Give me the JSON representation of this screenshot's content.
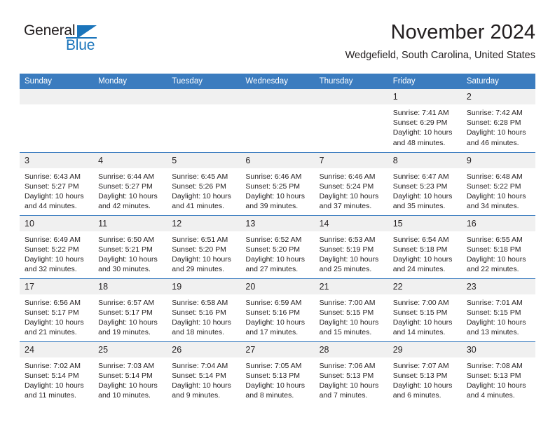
{
  "brand": {
    "name_part1": "General",
    "name_part2": "Blue"
  },
  "header": {
    "month_title": "November 2024",
    "location": "Wedgefield, South Carolina, United States"
  },
  "colors": {
    "header_blue": "#3b7cbf",
    "brand_blue": "#1b75bb",
    "daynum_band": "#f0f0f0",
    "text": "#231f20"
  },
  "weekday_headers": [
    "Sunday",
    "Monday",
    "Tuesday",
    "Wednesday",
    "Thursday",
    "Friday",
    "Saturday"
  ],
  "labels": {
    "sunrise_prefix": "Sunrise:",
    "sunset_prefix": "Sunset:",
    "daylight_prefix": "Daylight:"
  },
  "weeks": [
    [
      {
        "day": "",
        "blank": true,
        "line1": "",
        "line2": "",
        "line3": "",
        "line4": ""
      },
      {
        "day": "",
        "blank": true,
        "line1": "",
        "line2": "",
        "line3": "",
        "line4": ""
      },
      {
        "day": "",
        "blank": true,
        "line1": "",
        "line2": "",
        "line3": "",
        "line4": ""
      },
      {
        "day": "",
        "blank": true,
        "line1": "",
        "line2": "",
        "line3": "",
        "line4": ""
      },
      {
        "day": "",
        "blank": true,
        "line1": "",
        "line2": "",
        "line3": "",
        "line4": ""
      },
      {
        "day": "1",
        "blank": false,
        "line1": "Sunrise: 7:41 AM",
        "line2": "Sunset: 6:29 PM",
        "line3": "Daylight: 10 hours",
        "line4": "and 48 minutes."
      },
      {
        "day": "2",
        "blank": false,
        "line1": "Sunrise: 7:42 AM",
        "line2": "Sunset: 6:28 PM",
        "line3": "Daylight: 10 hours",
        "line4": "and 46 minutes."
      }
    ],
    [
      {
        "day": "3",
        "blank": false,
        "line1": "Sunrise: 6:43 AM",
        "line2": "Sunset: 5:27 PM",
        "line3": "Daylight: 10 hours",
        "line4": "and 44 minutes."
      },
      {
        "day": "4",
        "blank": false,
        "line1": "Sunrise: 6:44 AM",
        "line2": "Sunset: 5:27 PM",
        "line3": "Daylight: 10 hours",
        "line4": "and 42 minutes."
      },
      {
        "day": "5",
        "blank": false,
        "line1": "Sunrise: 6:45 AM",
        "line2": "Sunset: 5:26 PM",
        "line3": "Daylight: 10 hours",
        "line4": "and 41 minutes."
      },
      {
        "day": "6",
        "blank": false,
        "line1": "Sunrise: 6:46 AM",
        "line2": "Sunset: 5:25 PM",
        "line3": "Daylight: 10 hours",
        "line4": "and 39 minutes."
      },
      {
        "day": "7",
        "blank": false,
        "line1": "Sunrise: 6:46 AM",
        "line2": "Sunset: 5:24 PM",
        "line3": "Daylight: 10 hours",
        "line4": "and 37 minutes."
      },
      {
        "day": "8",
        "blank": false,
        "line1": "Sunrise: 6:47 AM",
        "line2": "Sunset: 5:23 PM",
        "line3": "Daylight: 10 hours",
        "line4": "and 35 minutes."
      },
      {
        "day": "9",
        "blank": false,
        "line1": "Sunrise: 6:48 AM",
        "line2": "Sunset: 5:22 PM",
        "line3": "Daylight: 10 hours",
        "line4": "and 34 minutes."
      }
    ],
    [
      {
        "day": "10",
        "blank": false,
        "line1": "Sunrise: 6:49 AM",
        "line2": "Sunset: 5:22 PM",
        "line3": "Daylight: 10 hours",
        "line4": "and 32 minutes."
      },
      {
        "day": "11",
        "blank": false,
        "line1": "Sunrise: 6:50 AM",
        "line2": "Sunset: 5:21 PM",
        "line3": "Daylight: 10 hours",
        "line4": "and 30 minutes."
      },
      {
        "day": "12",
        "blank": false,
        "line1": "Sunrise: 6:51 AM",
        "line2": "Sunset: 5:20 PM",
        "line3": "Daylight: 10 hours",
        "line4": "and 29 minutes."
      },
      {
        "day": "13",
        "blank": false,
        "line1": "Sunrise: 6:52 AM",
        "line2": "Sunset: 5:20 PM",
        "line3": "Daylight: 10 hours",
        "line4": "and 27 minutes."
      },
      {
        "day": "14",
        "blank": false,
        "line1": "Sunrise: 6:53 AM",
        "line2": "Sunset: 5:19 PM",
        "line3": "Daylight: 10 hours",
        "line4": "and 25 minutes."
      },
      {
        "day": "15",
        "blank": false,
        "line1": "Sunrise: 6:54 AM",
        "line2": "Sunset: 5:18 PM",
        "line3": "Daylight: 10 hours",
        "line4": "and 24 minutes."
      },
      {
        "day": "16",
        "blank": false,
        "line1": "Sunrise: 6:55 AM",
        "line2": "Sunset: 5:18 PM",
        "line3": "Daylight: 10 hours",
        "line4": "and 22 minutes."
      }
    ],
    [
      {
        "day": "17",
        "blank": false,
        "line1": "Sunrise: 6:56 AM",
        "line2": "Sunset: 5:17 PM",
        "line3": "Daylight: 10 hours",
        "line4": "and 21 minutes."
      },
      {
        "day": "18",
        "blank": false,
        "line1": "Sunrise: 6:57 AM",
        "line2": "Sunset: 5:17 PM",
        "line3": "Daylight: 10 hours",
        "line4": "and 19 minutes."
      },
      {
        "day": "19",
        "blank": false,
        "line1": "Sunrise: 6:58 AM",
        "line2": "Sunset: 5:16 PM",
        "line3": "Daylight: 10 hours",
        "line4": "and 18 minutes."
      },
      {
        "day": "20",
        "blank": false,
        "line1": "Sunrise: 6:59 AM",
        "line2": "Sunset: 5:16 PM",
        "line3": "Daylight: 10 hours",
        "line4": "and 17 minutes."
      },
      {
        "day": "21",
        "blank": false,
        "line1": "Sunrise: 7:00 AM",
        "line2": "Sunset: 5:15 PM",
        "line3": "Daylight: 10 hours",
        "line4": "and 15 minutes."
      },
      {
        "day": "22",
        "blank": false,
        "line1": "Sunrise: 7:00 AM",
        "line2": "Sunset: 5:15 PM",
        "line3": "Daylight: 10 hours",
        "line4": "and 14 minutes."
      },
      {
        "day": "23",
        "blank": false,
        "line1": "Sunrise: 7:01 AM",
        "line2": "Sunset: 5:15 PM",
        "line3": "Daylight: 10 hours",
        "line4": "and 13 minutes."
      }
    ],
    [
      {
        "day": "24",
        "blank": false,
        "line1": "Sunrise: 7:02 AM",
        "line2": "Sunset: 5:14 PM",
        "line3": "Daylight: 10 hours",
        "line4": "and 11 minutes."
      },
      {
        "day": "25",
        "blank": false,
        "line1": "Sunrise: 7:03 AM",
        "line2": "Sunset: 5:14 PM",
        "line3": "Daylight: 10 hours",
        "line4": "and 10 minutes."
      },
      {
        "day": "26",
        "blank": false,
        "line1": "Sunrise: 7:04 AM",
        "line2": "Sunset: 5:14 PM",
        "line3": "Daylight: 10 hours",
        "line4": "and 9 minutes."
      },
      {
        "day": "27",
        "blank": false,
        "line1": "Sunrise: 7:05 AM",
        "line2": "Sunset: 5:13 PM",
        "line3": "Daylight: 10 hours",
        "line4": "and 8 minutes."
      },
      {
        "day": "28",
        "blank": false,
        "line1": "Sunrise: 7:06 AM",
        "line2": "Sunset: 5:13 PM",
        "line3": "Daylight: 10 hours",
        "line4": "and 7 minutes."
      },
      {
        "day": "29",
        "blank": false,
        "line1": "Sunrise: 7:07 AM",
        "line2": "Sunset: 5:13 PM",
        "line3": "Daylight: 10 hours",
        "line4": "and 6 minutes."
      },
      {
        "day": "30",
        "blank": false,
        "line1": "Sunrise: 7:08 AM",
        "line2": "Sunset: 5:13 PM",
        "line3": "Daylight: 10 hours",
        "line4": "and 4 minutes."
      }
    ]
  ]
}
